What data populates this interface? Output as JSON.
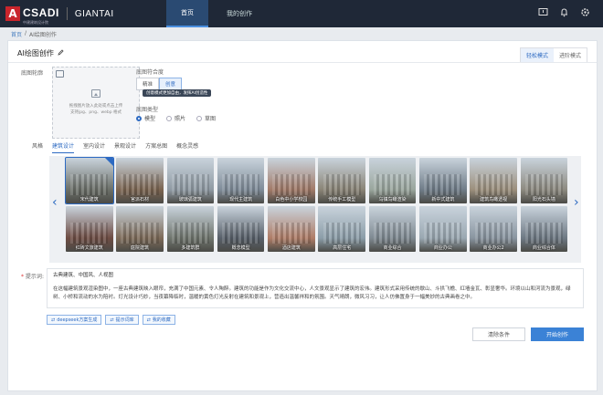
{
  "header": {
    "logo_text": "CSADI",
    "logo_sub": "中建建筑设计院",
    "brand2": "GIANTAI",
    "nav": [
      {
        "label": "首页",
        "active": true
      },
      {
        "label": "我的创作",
        "active": false
      }
    ],
    "icons": [
      "screen-icon",
      "bell-icon",
      "settings-icon"
    ]
  },
  "breadcrumb": {
    "home": "首页",
    "sep": "/",
    "current": "AI绘图创作"
  },
  "panel": {
    "title": "AI绘图创作",
    "modes": [
      {
        "label": "轻松模式",
        "active": true
      },
      {
        "label": "进阶模式",
        "active": false
      }
    ]
  },
  "left": {
    "outline_label": "底图轮廓",
    "upload_hint_1": "拖拽图片放入此处或点击上传",
    "upload_hint_2": "支持jpg、png、webp 格式"
  },
  "fit": {
    "label": "底图符合度",
    "options": [
      {
        "label": "精准",
        "active": false
      },
      {
        "label": "创意",
        "active": true
      }
    ],
    "tooltip": "创意模式更加自由，发挥AI创造性"
  },
  "type": {
    "label": "底图类型",
    "options": [
      {
        "label": "模型",
        "checked": true
      },
      {
        "label": "照片",
        "checked": false
      },
      {
        "label": "草图",
        "checked": false
      }
    ]
  },
  "style": {
    "label": "风格",
    "tabs": [
      {
        "label": "建筑设计",
        "active": true
      },
      {
        "label": "室内设计",
        "active": false
      },
      {
        "label": "景观设计",
        "active": false
      },
      {
        "label": "方案总图",
        "active": false
      },
      {
        "label": "概念灵感",
        "active": false
      }
    ],
    "items": [
      {
        "label": "宋代建筑",
        "selected": true,
        "color": "#6b6f68"
      },
      {
        "label": "官派石材",
        "selected": false,
        "color": "#7b6450"
      },
      {
        "label": "玻璃弧建筑",
        "selected": false,
        "color": "#8f9aa3"
      },
      {
        "label": "现代主建筑",
        "selected": false,
        "color": "#7f8c99"
      },
      {
        "label": "白色中小学校园",
        "selected": false,
        "color": "#a27a68"
      },
      {
        "label": "传统手工模型",
        "selected": false,
        "color": "#8a8476"
      },
      {
        "label": "乌镇鸟瞰渲染",
        "selected": false,
        "color": "#9aa69d"
      },
      {
        "label": "新中式建筑",
        "selected": false,
        "color": "#6f7c88"
      },
      {
        "label": "建筑鸟瞰透视",
        "selected": false,
        "color": "#9c8f7c"
      },
      {
        "label": "阳光石头墙",
        "selected": false,
        "color": "#8d8a80"
      },
      {
        "label": "红砖文旅建筑",
        "selected": false,
        "color": "#6e4c43"
      },
      {
        "label": "庭院建筑",
        "selected": false,
        "color": "#7d6a58"
      },
      {
        "label": "多建筑群",
        "selected": false,
        "color": "#6f756d"
      },
      {
        "label": "概念模型",
        "selected": false,
        "color": "#58606a"
      },
      {
        "label": "酒店建筑",
        "selected": false,
        "color": "#b07d67"
      },
      {
        "label": "高层住宅",
        "selected": false,
        "color": "#8c9ea9"
      },
      {
        "label": "商业综合",
        "selected": false,
        "color": "#7f8a92"
      },
      {
        "label": "商业办公",
        "selected": false,
        "color": "#9aa8b2"
      },
      {
        "label": "商业办公2",
        "selected": false,
        "color": "#8995a0"
      },
      {
        "label": "商业综合体",
        "selected": false,
        "color": "#6e7984"
      }
    ]
  },
  "prompt": {
    "label": "提示词",
    "title": "古典建筑、中国风、人视图",
    "body": "在这幅建筑景观渲染图中，一座古典建筑映入眼帘，充满了中国元素、令人陶醉。建筑的功能是作为文化交流中心，人文景观显示了建筑的宏伟。建筑形式采用传统的歇山、斗拱飞檐、红墙金瓦、彰显奢华。环境以山和河流为景观，绿树、小桥和流动的水为陪衬。灯光设计巧妙，当夜幕降临时，温暖的黄色灯光反射在建筑和景观上，营造出温馨祥和的氛围。天气晴朗，微风习习，让人仿佛置身于一幅美妙的古典画卷之中。",
    "chips": [
      "deepseek方案生成",
      "提示词库",
      "我的收藏"
    ]
  },
  "actions": {
    "clear": "清除条件",
    "start": "开始创作"
  }
}
